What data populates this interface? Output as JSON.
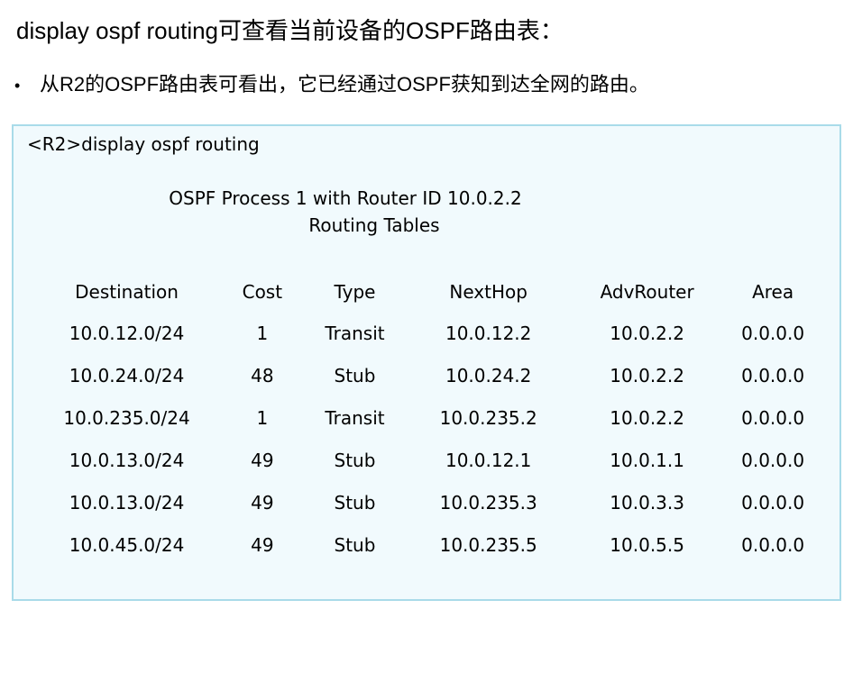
{
  "heading": {
    "cmd": "display ospf routing",
    "desc": "可查看当前设备的OSPF路由表："
  },
  "bullet": {
    "marker": "•",
    "text": "从R2的OSPF路由表可看出，它已经通过OSPF获知到达全网的路由。"
  },
  "terminal": {
    "command": "<R2>display ospf routing",
    "process_line": "OSPF Process 1 with Router ID 10.0.2.2",
    "tables_title": "Routing Tables",
    "columns": [
      "Destination",
      "Cost",
      "Type",
      "NextHop",
      "AdvRouter",
      "Area"
    ],
    "rows": [
      [
        "10.0.12.0/24",
        "1",
        "Transit",
        "10.0.12.2",
        "10.0.2.2",
        "0.0.0.0"
      ],
      [
        "10.0.24.0/24",
        "48",
        "Stub",
        "10.0.24.2",
        "10.0.2.2",
        "0.0.0.0"
      ],
      [
        "10.0.235.0/24",
        "1",
        "Transit",
        "10.0.235.2",
        "10.0.2.2",
        "0.0.0.0"
      ],
      [
        "10.0.13.0/24",
        "49",
        "Stub",
        "10.0.12.1",
        "10.0.1.1",
        "0.0.0.0"
      ],
      [
        "10.0.13.0/24",
        "49",
        "Stub",
        "10.0.235.3",
        "10.0.3.3",
        "0.0.0.0"
      ],
      [
        "10.0.45.0/24",
        "49",
        "Stub",
        "10.0.235.5",
        "10.0.5.5",
        "0.0.0.0"
      ]
    ]
  },
  "colors": {
    "panel_background": "#f1fafd",
    "panel_border": "#a9dbe9",
    "text": "#000000"
  }
}
